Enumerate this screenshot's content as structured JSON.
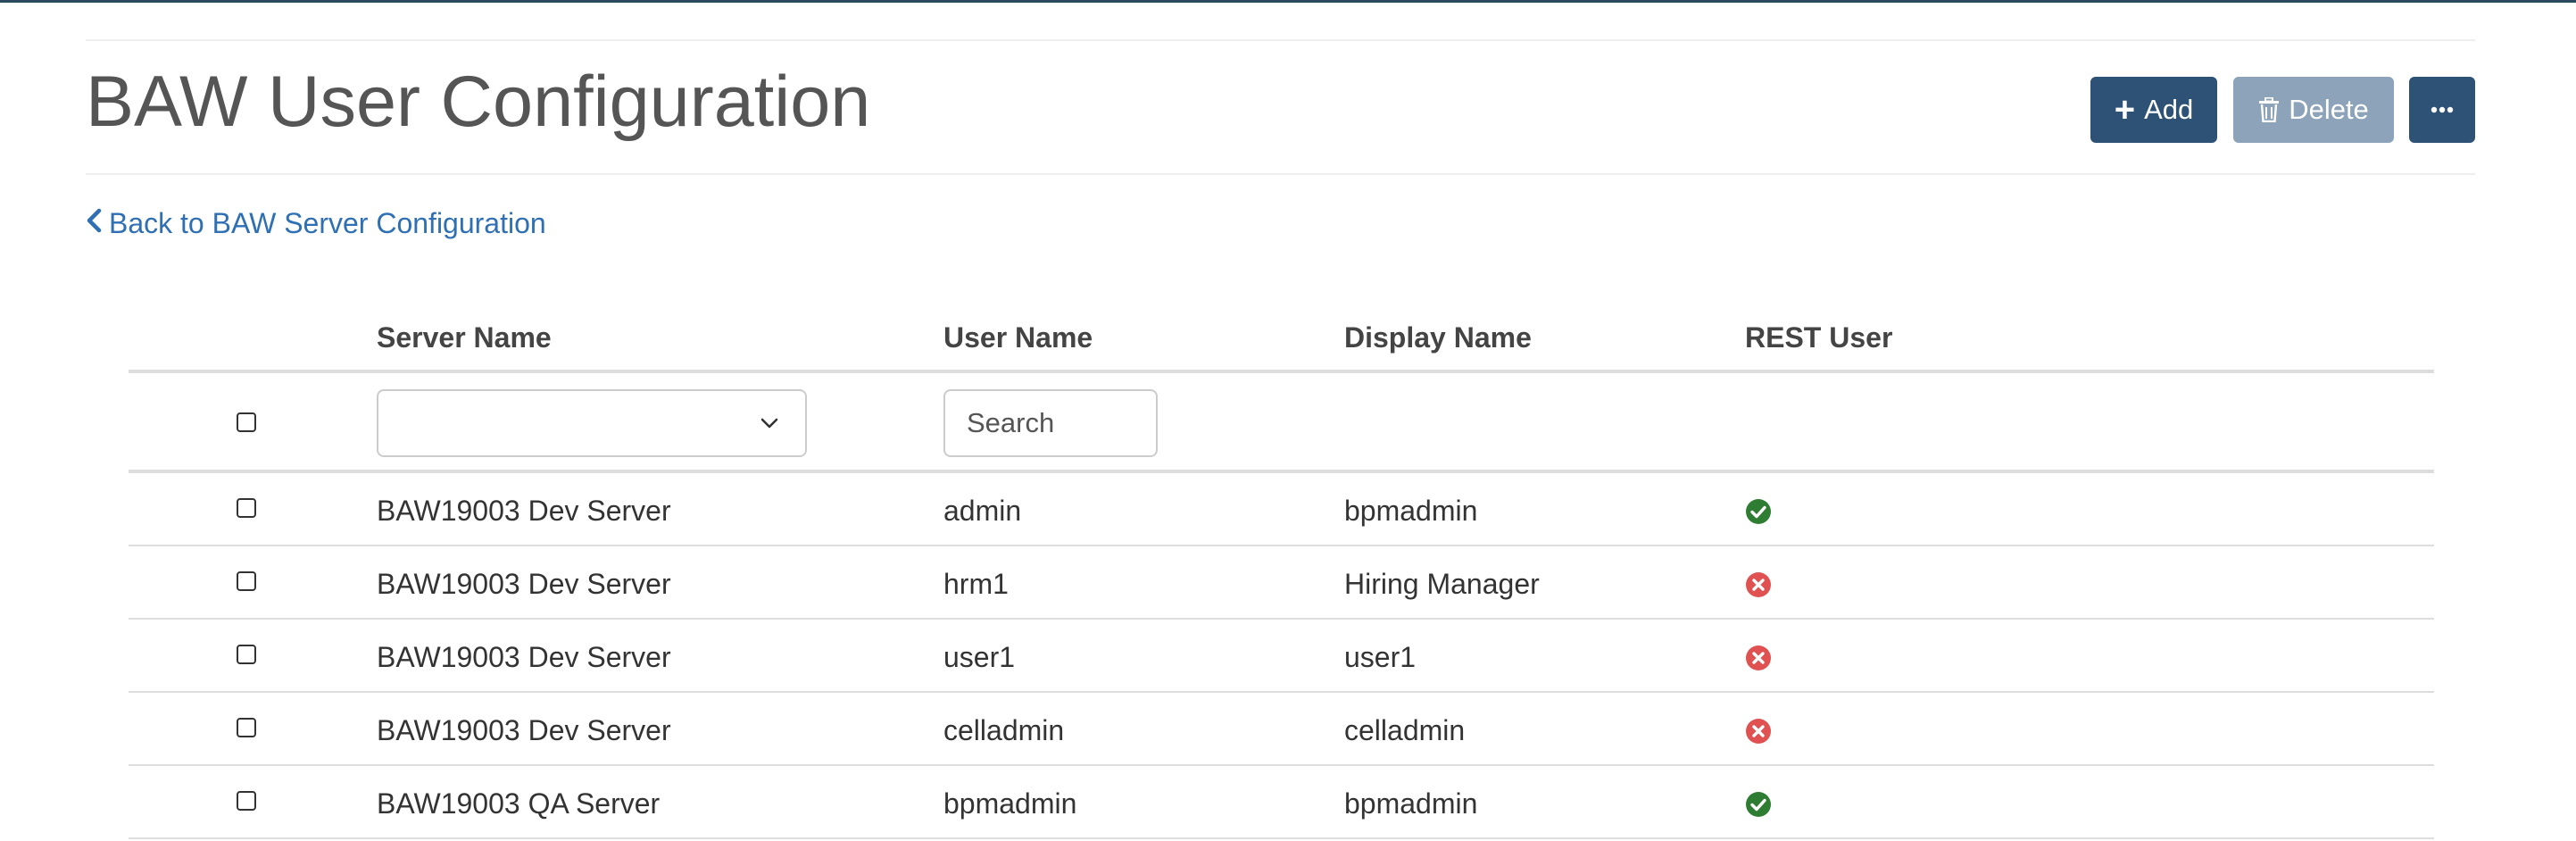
{
  "page": {
    "title": "BAW User Configuration",
    "back_link": "Back to BAW Server Configuration"
  },
  "toolbar": {
    "add_label": "Add",
    "delete_label": "Delete"
  },
  "table": {
    "columns": [
      "Server Name",
      "User Name",
      "Display Name",
      "REST User"
    ],
    "filters": {
      "server_select_value": "",
      "user_search_placeholder": "Search"
    },
    "rows": [
      {
        "server": "BAW19003 Dev Server",
        "user": "admin",
        "display": "bpmadmin",
        "rest_user": true
      },
      {
        "server": "BAW19003 Dev Server",
        "user": "hrm1",
        "display": "Hiring Manager",
        "rest_user": false
      },
      {
        "server": "BAW19003 Dev Server",
        "user": "user1",
        "display": "user1",
        "rest_user": false
      },
      {
        "server": "BAW19003 Dev Server",
        "user": "celladmin",
        "display": "celladmin",
        "rest_user": false
      },
      {
        "server": "BAW19003 QA Server",
        "user": "bpmadmin",
        "display": "bpmadmin",
        "rest_user": true
      }
    ]
  },
  "icons": {
    "add": "plus-icon",
    "delete": "trash-icon",
    "more": "ellipsis-icon",
    "back": "chevron-left-icon",
    "rest_true": "check-circle-icon",
    "rest_false": "x-circle-icon"
  },
  "colors": {
    "primary": "#2e5275",
    "disabled": "#8da3b9",
    "link": "#2f6fb4",
    "success": "#2e7d32",
    "danger": "#e05252"
  }
}
